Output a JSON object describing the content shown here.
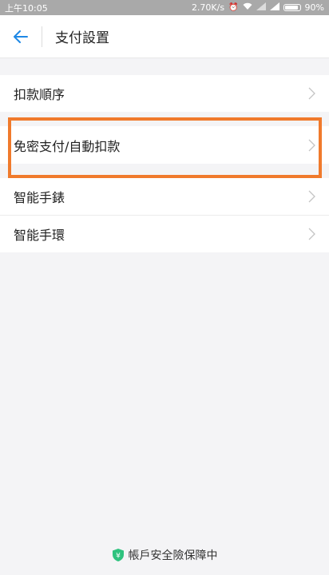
{
  "status_bar": {
    "time": "上午10:05",
    "network_speed": "2.70K/s",
    "battery": "90%"
  },
  "header": {
    "title": "支付設置"
  },
  "menu": [
    {
      "label": "扣款順序"
    },
    {
      "label": "免密支付/自動扣款"
    },
    {
      "label": "智能手錶"
    },
    {
      "label": "智能手環"
    }
  ],
  "footer": {
    "text": "帳戶安全險保障中"
  },
  "colors": {
    "accent": "#1e88e5",
    "highlight": "#f07a2c",
    "shield": "#2ec27e"
  }
}
